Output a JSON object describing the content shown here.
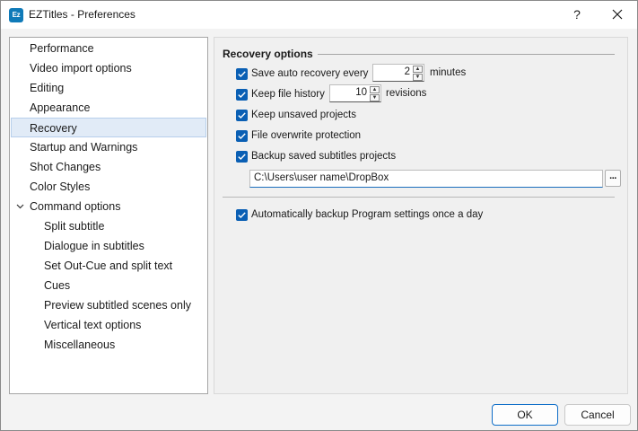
{
  "window": {
    "title": "EZTitles - Preferences",
    "app_icon_text": "Ez",
    "help_label": "?"
  },
  "nav": {
    "items": [
      {
        "label": "Performance",
        "level": 0
      },
      {
        "label": "Video import options",
        "level": 0
      },
      {
        "label": "Editing",
        "level": 0
      },
      {
        "label": "Appearance",
        "level": 0
      },
      {
        "label": "Recovery",
        "level": 0,
        "selected": true
      },
      {
        "label": "Startup and Warnings",
        "level": 0
      },
      {
        "label": "Shot Changes",
        "level": 0
      },
      {
        "label": "Color Styles",
        "level": 0
      },
      {
        "label": "Command options",
        "level": 0,
        "expanded": true
      },
      {
        "label": "Split subtitle",
        "level": 1
      },
      {
        "label": "Dialogue in subtitles",
        "level": 1
      },
      {
        "label": "Set Out-Cue and split text",
        "level": 1
      },
      {
        "label": "Cues",
        "level": 1
      },
      {
        "label": "Preview subtitled scenes only",
        "level": 1
      },
      {
        "label": "Vertical text options",
        "level": 1
      },
      {
        "label": "Miscellaneous",
        "level": 1
      }
    ]
  },
  "recovery": {
    "group_title": "Recovery options",
    "save_auto_recovery": {
      "label": "Save auto recovery every",
      "checked": true,
      "value": "2",
      "unit": "minutes"
    },
    "keep_file_history": {
      "label": "Keep file history",
      "checked": true,
      "value": "10",
      "unit": "revisions"
    },
    "keep_unsaved": {
      "label": "Keep unsaved projects",
      "checked": true
    },
    "overwrite_protection": {
      "label": "File overwrite protection",
      "checked": true
    },
    "backup_saved": {
      "label": "Backup saved subtitles projects",
      "checked": true
    },
    "backup_path": "C:\\Users\\user name\\DropBox",
    "browse_label": "...",
    "auto_backup_settings": {
      "label": "Automatically backup Program settings once a day",
      "checked": true
    }
  },
  "buttons": {
    "ok": "OK",
    "cancel": "Cancel"
  },
  "colors": {
    "accent": "#0a5fb4",
    "selection": "#e1ebf7"
  }
}
